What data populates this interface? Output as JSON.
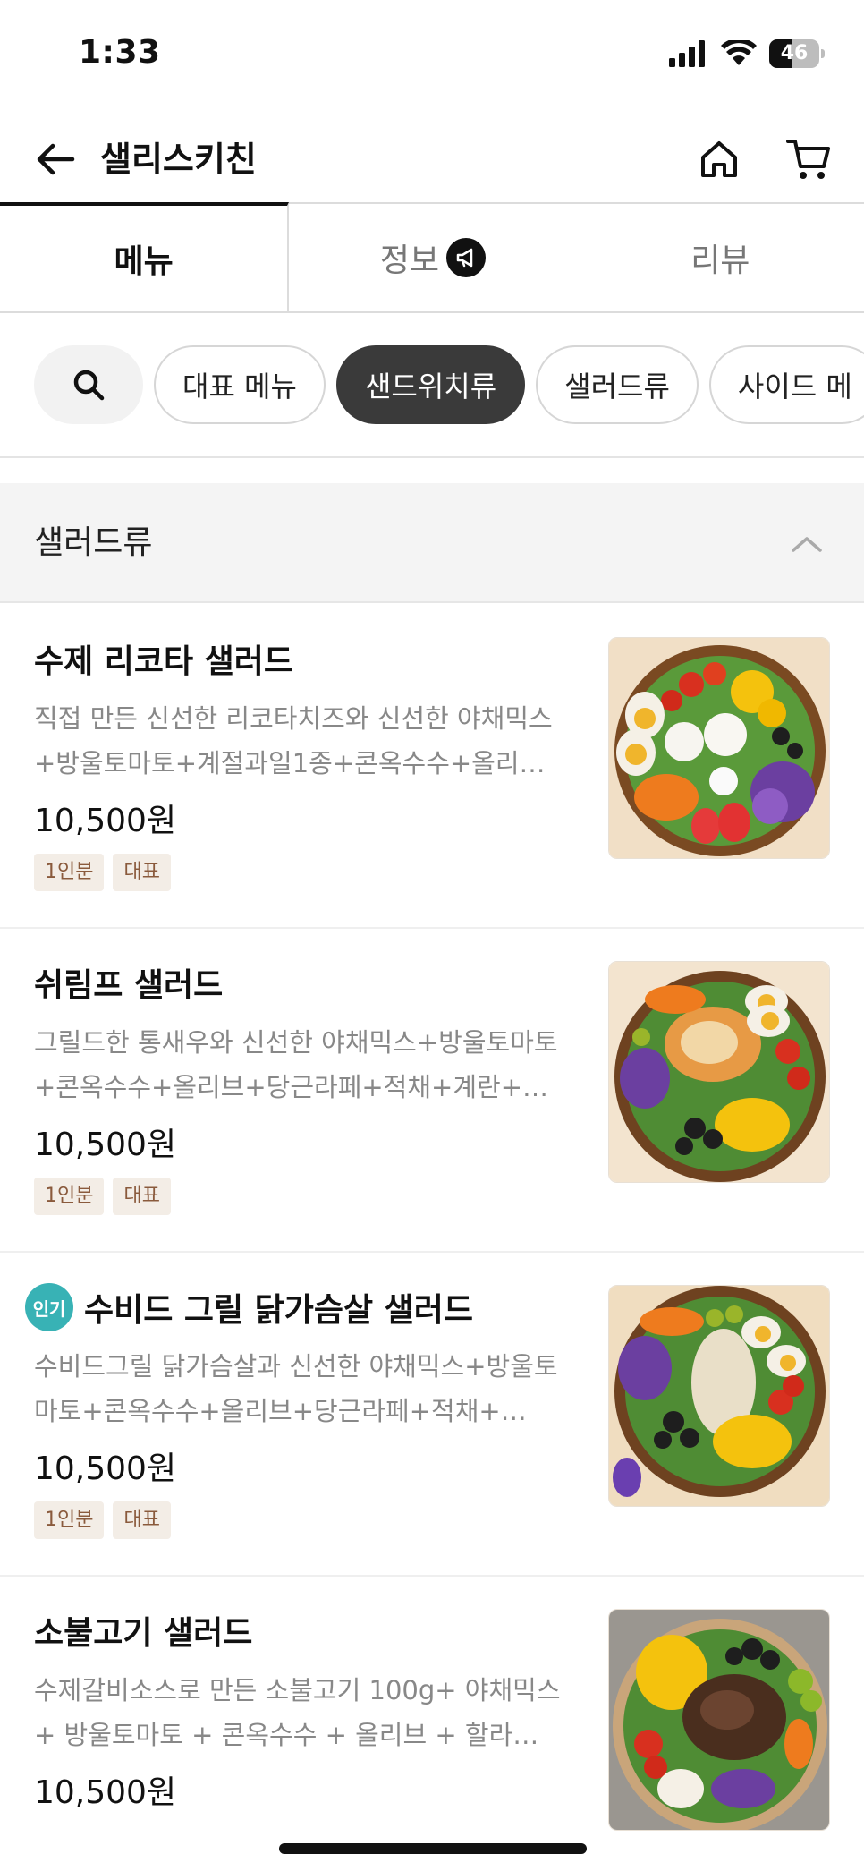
{
  "status_bar": {
    "time": "1:33",
    "battery": "46",
    "battery_level": 0.46
  },
  "header": {
    "store_name": "샐리스키친"
  },
  "tabs": [
    {
      "label": "메뉴",
      "active": true
    },
    {
      "label": "정보",
      "active": false
    },
    {
      "label": "리뷰",
      "active": false
    }
  ],
  "categories": [
    {
      "label": "대표 메뉴",
      "selected": false
    },
    {
      "label": "샌드위치류",
      "selected": true
    },
    {
      "label": "샐러드류",
      "selected": false
    },
    {
      "label": "사이드 메",
      "selected": false
    }
  ],
  "section": {
    "title": "샐러드류"
  },
  "menu_items": [
    {
      "name": "수제 리코타 샐러드",
      "popular": false,
      "description": "직접 만든 신선한 리코타치즈와 신선한 야채믹스+방울토마토+계절과일1종+콘옥수수+올리…",
      "price": "10,500원",
      "tags": [
        "1인분",
        "대표"
      ]
    },
    {
      "name": "쉬림프 샐러드",
      "popular": false,
      "description": "그릴드한 통새우와 신선한 야채믹스+방울토마토+콘옥수수+올리브+당근라페+적채+계란+…",
      "price": "10,500원",
      "tags": [
        "1인분",
        "대표"
      ]
    },
    {
      "name": "수비드 그릴 닭가슴살 샐러드",
      "popular": true,
      "popular_label": "인기",
      "description": "수비드그릴 닭가슴살과 신선한 야채믹스+방울토마토+콘옥수수+올리브+당근라페+적채+…",
      "price": "10,500원",
      "tags": [
        "1인분",
        "대표"
      ]
    },
    {
      "name": "소불고기 샐러드",
      "popular": false,
      "description": "수제갈비소스로 만든 소불고기 100g+ 야채믹스 + 방울토마토 + 콘옥수수 + 올리브 + 할라…",
      "price": "10,500원",
      "tags": []
    }
  ],
  "colors": {
    "accent_dark": "#3a3a3a",
    "tag_bg": "#f3ede6",
    "tag_text": "#8a5a3c",
    "popular_badge": "#38b2b5"
  }
}
